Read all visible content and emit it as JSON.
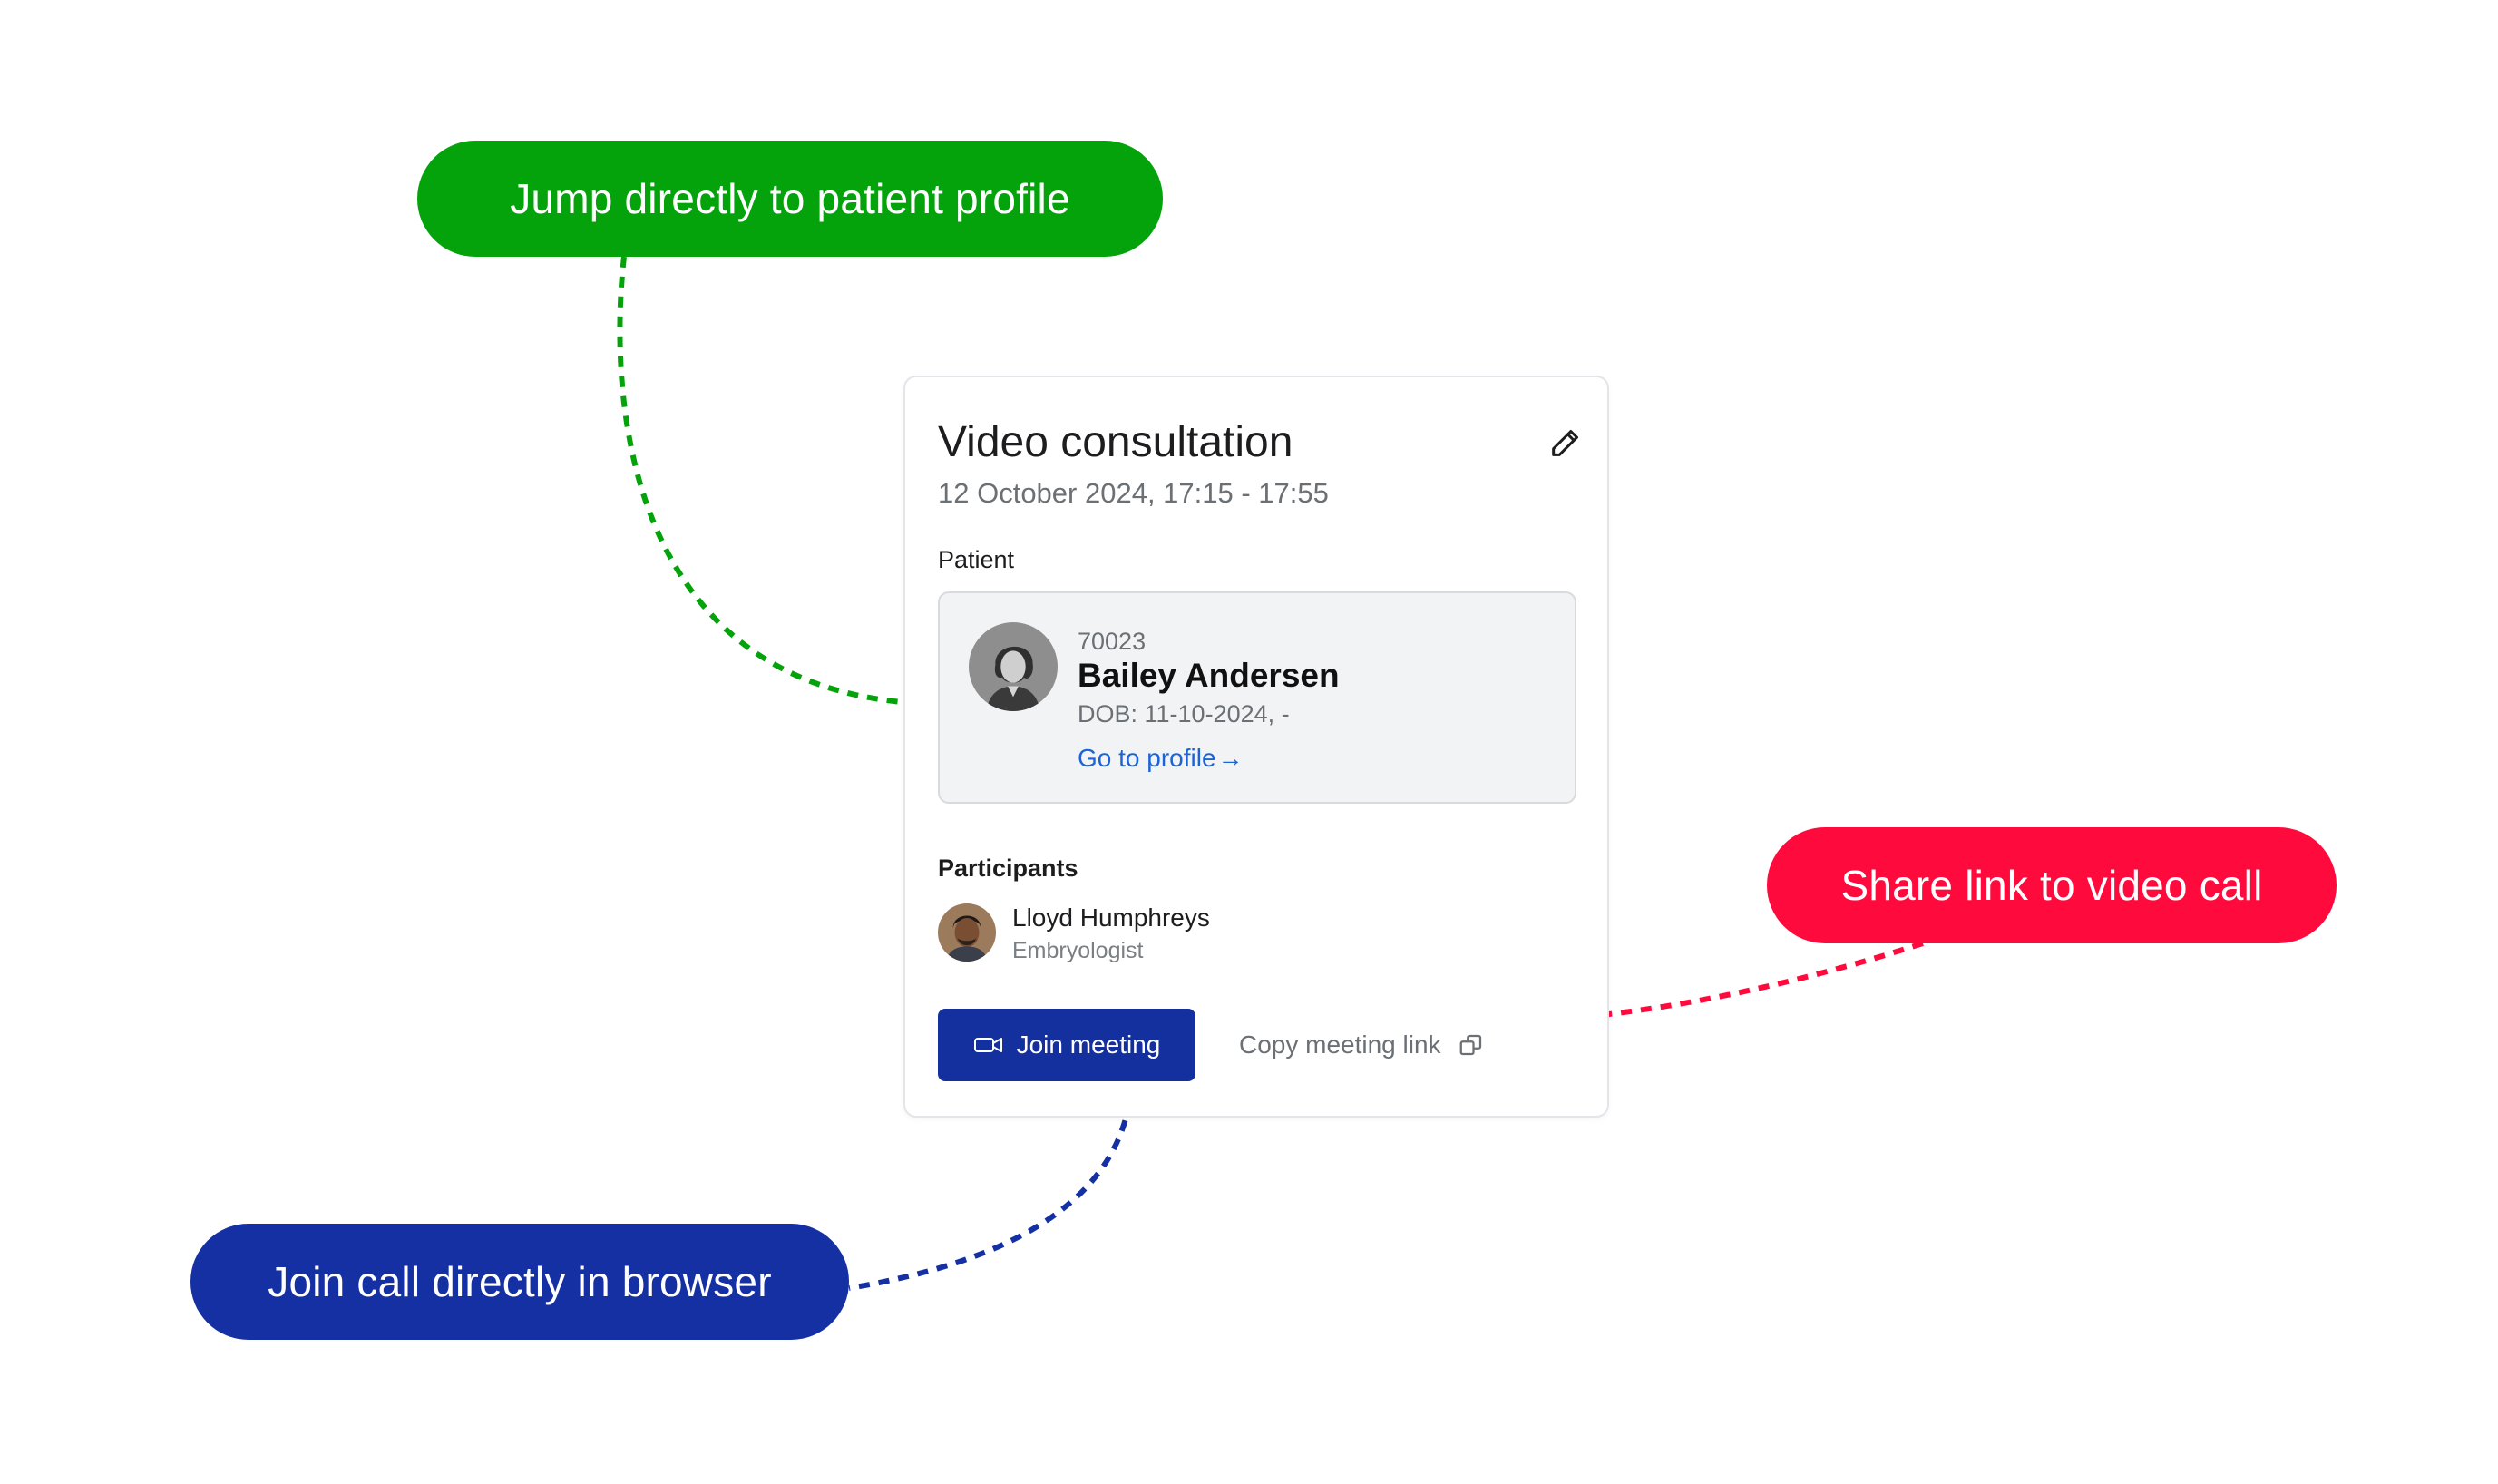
{
  "callouts": {
    "profile": "Jump directly to patient profile",
    "share": "Share link to video call",
    "join": "Join call directly in browser"
  },
  "card": {
    "title": "Video consultation",
    "datetime": "12 October 2024, 17:15 - 17:55",
    "patient_label": "Patient",
    "patient": {
      "id": "70023",
      "name": "Bailey Andersen",
      "dob": "DOB: 11-10-2024, -",
      "profile_link": "Go to profile",
      "profile_link_arrow": "→"
    },
    "participants_label": "Participants",
    "participants": [
      {
        "name": "Lloyd Humphreys",
        "role": "Embryologist"
      }
    ],
    "join_button": "Join meeting",
    "copy_link": "Copy meeting link"
  },
  "icons": {
    "edit": "pencil-icon",
    "video": "video-camera-icon",
    "copy": "copy-icon",
    "link_arrow": "arrow-right-icon"
  },
  "colors": {
    "green_callout": "#05a30b",
    "red_callout": "#ff0a3d",
    "blue_callout": "#1530a3",
    "join_button": "#14309f",
    "link": "#1d63d8"
  }
}
